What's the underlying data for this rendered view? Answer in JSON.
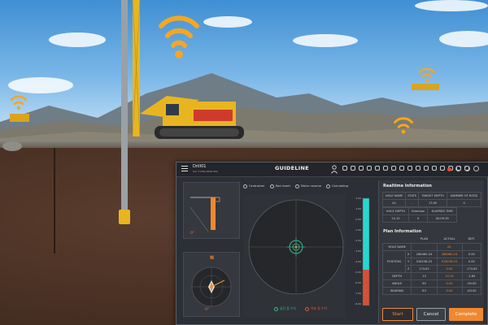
{
  "header": {
    "drill_name": "Drill01",
    "drill_sub": "Ser. F-DRL-0000-001",
    "title": "GUIDELINE"
  },
  "left_panel": {
    "depth_angle": "0°",
    "compass_angle": "0°",
    "north_label": "N"
  },
  "options": [
    {
      "label": "Centralizer",
      "selected": false
    },
    {
      "label": "Rod insert",
      "selected": false
    },
    {
      "label": "Motor reverse",
      "selected": false
    },
    {
      "label": "Calculating",
      "selected": false
    }
  ],
  "legend": {
    "current": "굴진 중 수치",
    "target": "목표 중 수치"
  },
  "depth_scale": [
    "2.00",
    "1.00",
    "0.00",
    "-1.00",
    "-2.00",
    "-3.00",
    "-4.00",
    "-5.00",
    "-6.00",
    "-7.00",
    "-8.00"
  ],
  "realtime": {
    "title": "Realtime Information",
    "headers1": [
      "HOLE NAME",
      "STATE",
      "TARGET DEPTH",
      "NUMBER OF RODS"
    ],
    "row1": [
      "A1",
      "-",
      "13.00",
      "0"
    ],
    "headers2": [
      "HOLE DEPTH",
      "Direction",
      "ELAPSED TIME"
    ],
    "row2": [
      "10.15",
      "0",
      "00:00:35"
    ]
  },
  "plan": {
    "title": "Plan Information",
    "col_plan": "PLAN",
    "col_actual": "ACTUAL",
    "col_diff": "DIFF.",
    "hole_name_label": "HOLE NAME",
    "hole_name_actual": "A1",
    "position_label": "POSITION",
    "x_label": "X",
    "y_label": "Y",
    "z_label": "Z",
    "x_plan": "186460.24",
    "x_actual": "186460.24",
    "x_diff": "0.00",
    "y_plan": "518238.23",
    "y_actual": "518238.23",
    "y_diff": "0.00",
    "z_plan": "174.62",
    "z_actual": "0.00",
    "z_diff": "-174.62",
    "depth_label": "DEPTH",
    "depth_plan": "13",
    "depth_actual": "10.15",
    "depth_diff": "-2.85",
    "angle_label": "ANGLE",
    "angle_plan": "90",
    "angle_actual": "0.00",
    "angle_diff": "-90.00",
    "bearing_label": "BEARING",
    "bearing_plan": "63",
    "bearing_actual": "0.00",
    "bearing_diff": "-63.00"
  },
  "buttons": {
    "start": "Start",
    "cancel": "Cancel",
    "complete": "Complete"
  },
  "colors": {
    "accent": "#f0882f",
    "target_green": "#2fbf8f",
    "scale_cyan": "#28d6d0",
    "scale_red": "#d2523a"
  }
}
